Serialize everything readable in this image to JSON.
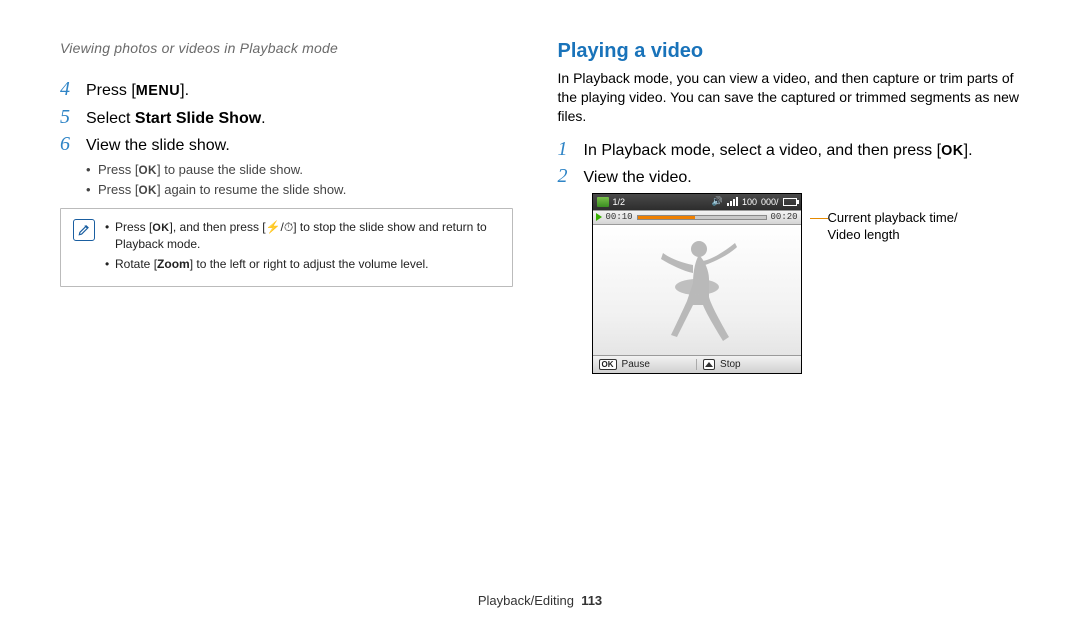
{
  "breadcrumb": "Viewing photos or videos in Playback mode",
  "left": {
    "steps": [
      {
        "n": "4",
        "prefix": "Press [",
        "kbd": "MENU",
        "suffix": "]."
      },
      {
        "n": "5",
        "prefix": "Select ",
        "bold": "Start Slide Show",
        "suffix": "."
      },
      {
        "n": "6",
        "prefix": "View the slide show."
      }
    ],
    "sub": {
      "a_prefix": "Press [",
      "a_kbd": "OK",
      "a_suffix": "] to pause the slide show.",
      "b_prefix": "Press [",
      "b_kbd": "OK",
      "b_suffix": "] again to resume the slide show."
    },
    "note": {
      "a_p1": "Press [",
      "a_k1": "OK",
      "a_p2": "], and then press [",
      "a_icons": "⚡/⏱",
      "a_p3": "] to stop the slide show and return to Playback mode.",
      "b_p1": "Rotate [",
      "b_bold": "Zoom",
      "b_p2": "] to the left or right to adjust the volume level."
    }
  },
  "right": {
    "heading": "Playing a video",
    "intro": "In Playback mode, you can view a video, and then capture or trim parts of the playing video. You can save the captured or trimmed segments as new files.",
    "steps": [
      {
        "n": "1",
        "prefix": "In Playback mode, select a video, and then press [",
        "kbd": "OK",
        "suffix": "]."
      },
      {
        "n": "2",
        "prefix": "View the video."
      }
    ],
    "screen": {
      "count": "1/2",
      "batt_pct": "100",
      "mem": "000/",
      "t_left": "00:10",
      "t_right": "00:20",
      "ok": "OK",
      "pause": "Pause",
      "stop": "Stop"
    },
    "callout": "Current playback time/\nVideo length"
  },
  "footer": {
    "section": "Playback/Editing",
    "page": "113"
  }
}
